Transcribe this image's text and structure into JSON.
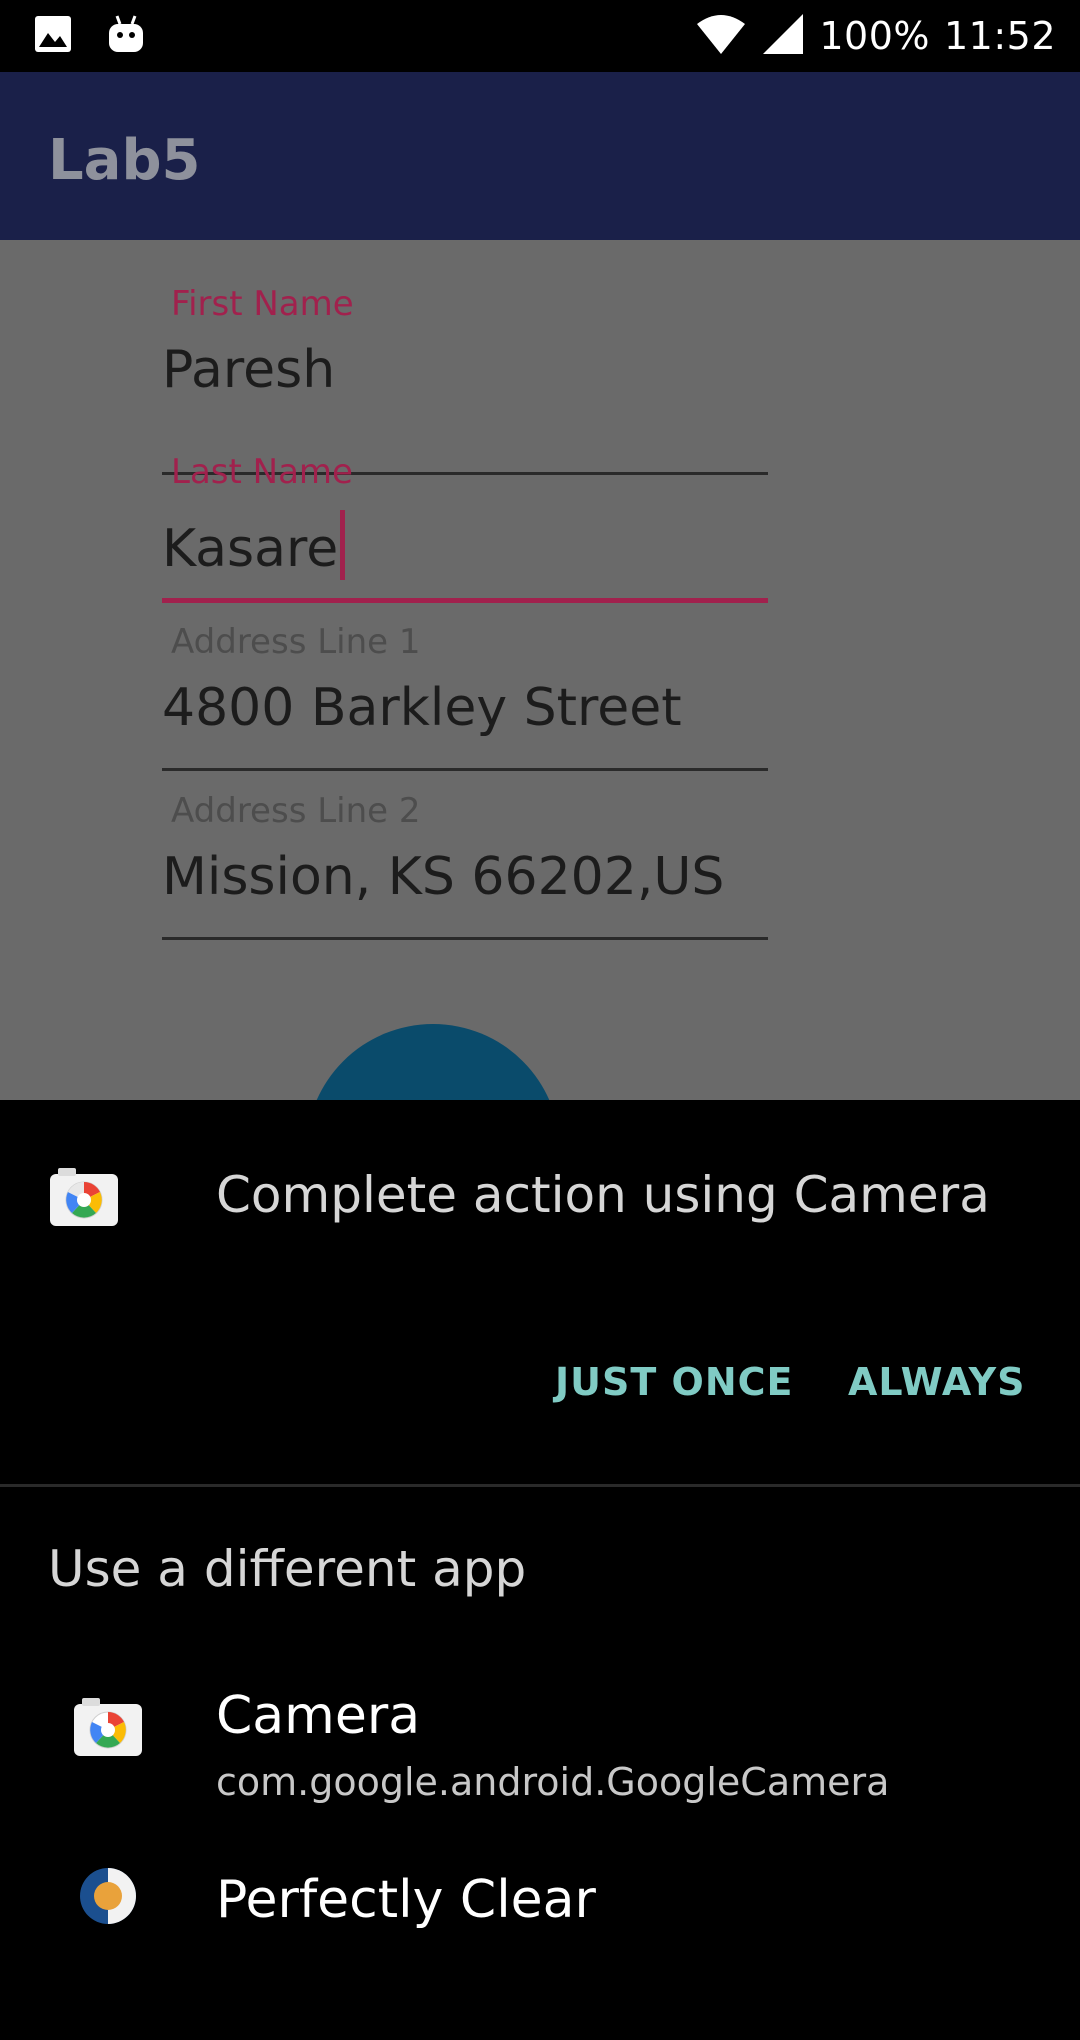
{
  "status_bar": {
    "battery": "100%",
    "time": "11:52",
    "icons": [
      "image-icon",
      "android-icon",
      "wifi-icon",
      "signal-icon"
    ]
  },
  "app_bar": {
    "title": "Lab5"
  },
  "form": {
    "first_name": {
      "label": "First Name",
      "value": "Paresh"
    },
    "last_name": {
      "label": "Last Name",
      "value": "Kasare"
    },
    "address1": {
      "label": "Address Line 1",
      "value": "4800 Barkley Street"
    },
    "address2": {
      "label": "Address Line 2",
      "value": "Mission, KS 66202,US"
    }
  },
  "sheet": {
    "title": "Complete action using Camera",
    "just_once": "JUST ONCE",
    "always": "ALWAYS",
    "subheader": "Use a different app",
    "apps": [
      {
        "name": "Camera",
        "package": "com.google.android.GoogleCamera"
      },
      {
        "name": "Perfectly Clear",
        "package": ""
      }
    ]
  },
  "colors": {
    "app_bar": "#1a2049",
    "accent": "#a1214d",
    "dialog_button": "#80cbc4",
    "fab": "#0a4b6b"
  }
}
